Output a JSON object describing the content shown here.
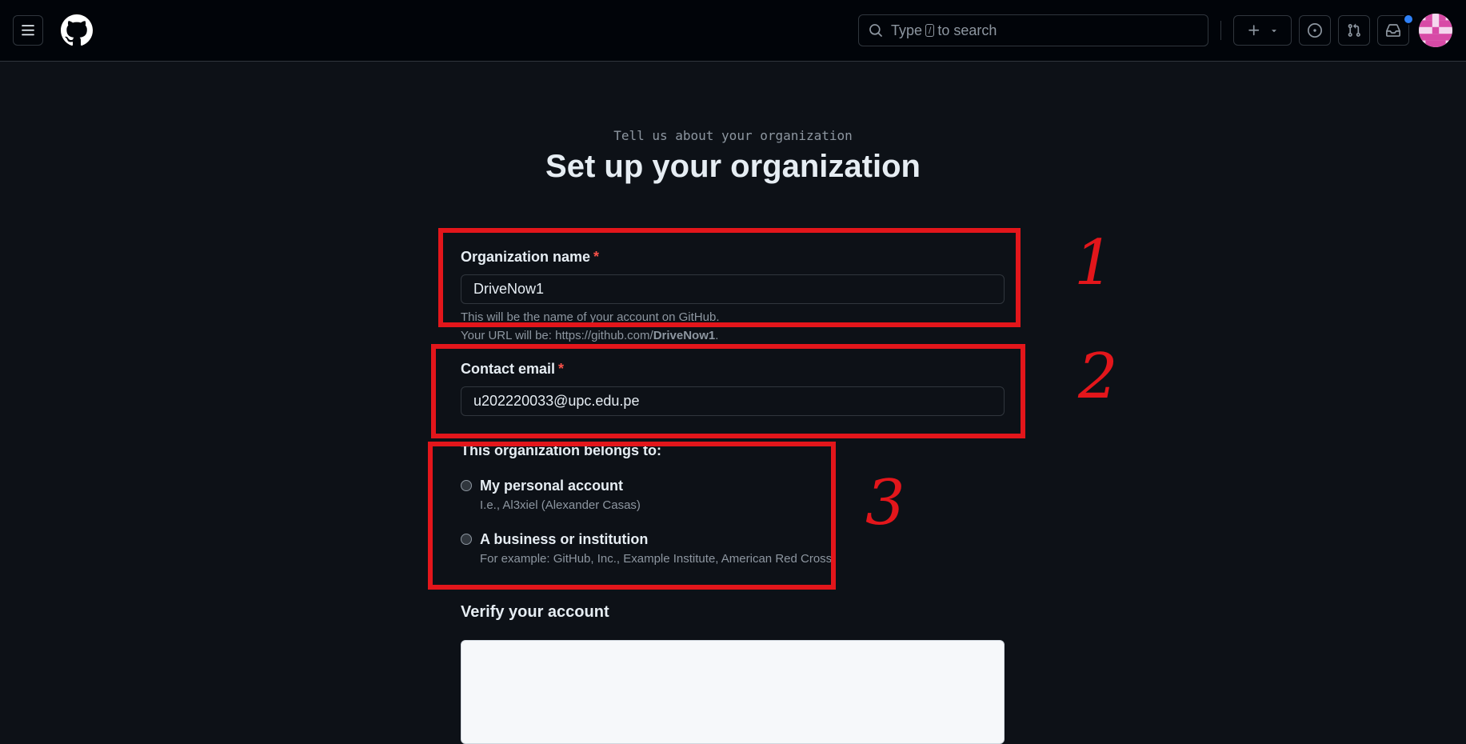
{
  "header": {
    "search_prefix": "Type",
    "search_key": "/",
    "search_suffix": "to search"
  },
  "page": {
    "subtitle": "Tell us about your organization",
    "title": "Set up your organization"
  },
  "form": {
    "org_name": {
      "label": "Organization name",
      "required_mark": "*",
      "value": "DriveNow1",
      "hint": "This will be the name of your account on GitHub.",
      "url_prefix": "Your URL will be: https://github.com/",
      "url_name": "DriveNow1",
      "url_suffix": "."
    },
    "email": {
      "label": "Contact email",
      "required_mark": "*",
      "value": "u202220033@upc.edu.pe"
    },
    "belongs": {
      "label": "This organization belongs to:",
      "options": [
        {
          "label": "My personal account",
          "description": "I.e., Al3xiel (Alexander Casas)"
        },
        {
          "label": "A business or institution",
          "description": "For example: GitHub, Inc., Example Institute, American Red Cross"
        }
      ]
    },
    "verify": {
      "label": "Verify your account"
    }
  },
  "annotations": {
    "numbers": [
      "1",
      "2",
      "3"
    ],
    "color": "#e3161b"
  },
  "colors": {
    "background": "#0d1117",
    "header_bg": "#010409",
    "required": "#f85149",
    "notification": "#2f81f7"
  }
}
